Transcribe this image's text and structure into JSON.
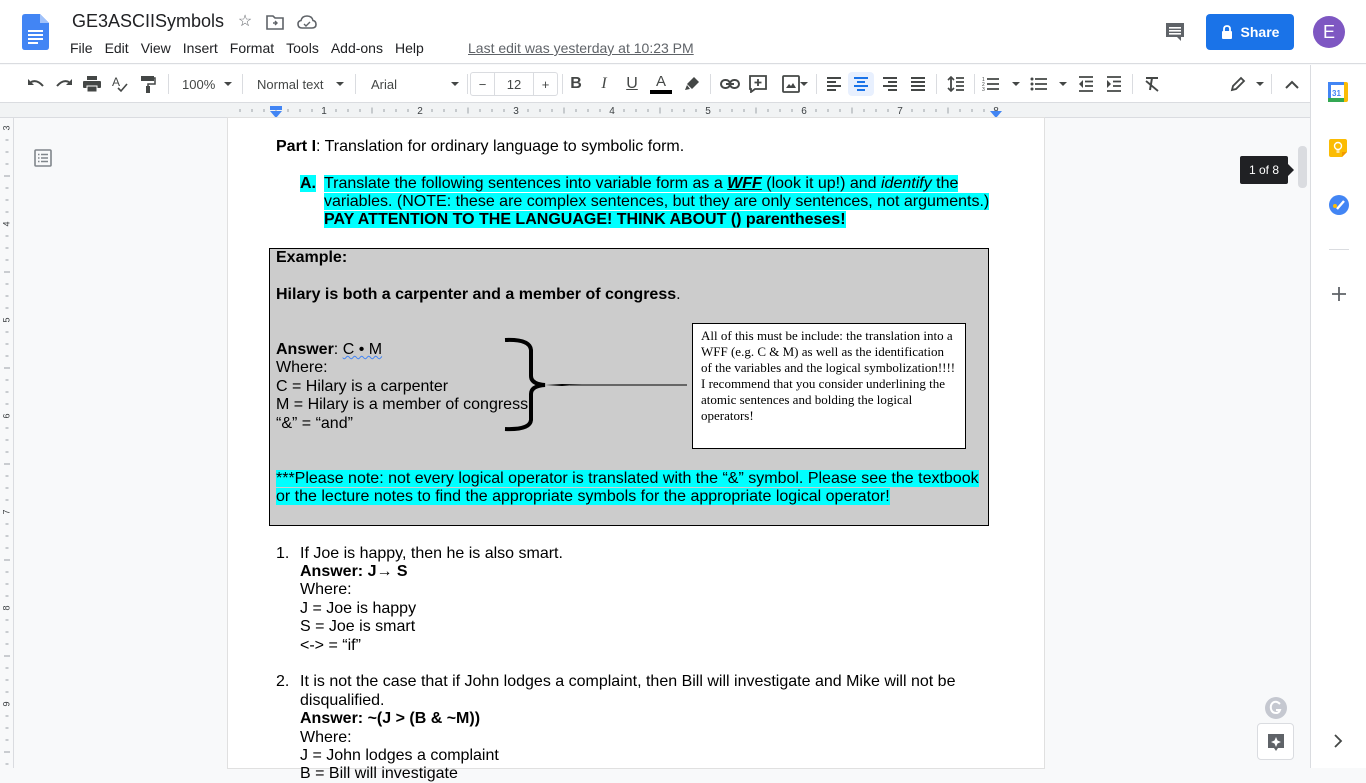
{
  "app": {
    "doc_title": "GE3ASCIISymbols",
    "last_edit": "Last edit was yesterday at 10:23 PM",
    "share_label": "Share",
    "avatar_initial": "E",
    "menu": [
      "File",
      "Edit",
      "View",
      "Insert",
      "Format",
      "Tools",
      "Add-ons",
      "Help"
    ]
  },
  "toolbar": {
    "zoom": "100%",
    "style": "Normal text",
    "font": "Arial",
    "font_size": "12",
    "minus": "−",
    "plus": "+",
    "active_align": "center",
    "text_color": "#000000"
  },
  "ruler": {
    "h_labels": [
      "1",
      "2",
      "3",
      "4",
      "5",
      "6",
      "7",
      "8"
    ],
    "v_labels": [
      "3",
      "4",
      "5",
      "6",
      "7",
      "8",
      "9"
    ]
  },
  "page_indicator": "1 of 8",
  "document": {
    "part_heading_bold": "Part I",
    "part_heading_rest": ": Translation for ordinary language to symbolic form.",
    "section_a": {
      "marker": "A.",
      "line1_a": "Translate the following sentences into variable form as a ",
      "line1_wff": "WFF",
      "line1_b": " (look it up!) and ",
      "line1_identify": "identify",
      "line1_c": " the",
      "line2": "variables. (NOTE: these are complex sentences, but they are only sentences, not arguments.)",
      "line3": "PAY ATTENTION TO THE LANGUAGE! THINK ABOUT () parentheses!"
    },
    "example": {
      "label": "Example:",
      "sentence": "Hilary is both a carpenter and a member of congress",
      "sentence_end": ".",
      "answer_label": "Answer",
      "answer_colon": ": ",
      "answer_value": "C • M",
      "where": "Where:",
      "vars": [
        "C = Hilary is a carpenter",
        "M = Hilary is a member of congress",
        "“&” = “and”"
      ],
      "note_box": "All of this must be include: the translation into a WFF (e.g. C & M) as well as the identification of the variables and the logical symbolization!!!! I recommend that you consider underlining the atomic sentences and bolding the logical operators!",
      "footnote_line1": "***Please note: not every logical operator is translated with the “&” symbol. Please see the textbook",
      "footnote_line2": "or the lecture notes to find the appropriate symbols for the appropriate logical operator!"
    },
    "items": [
      {
        "number": "1.",
        "question": "If Joe is happy, then he is also smart.",
        "answer": "Answer: J→ S",
        "where": "Where:",
        "vars": [
          "J = Joe is happy",
          "S = Joe is smart",
          "<-> = “if”"
        ]
      },
      {
        "number": "2.",
        "question_line1": "It is not the case that if John lodges a complaint, then Bill will investigate and Mike will not be",
        "question_line2": "disqualified.",
        "answer": "Answer: ~(J > (B & ~M))",
        "where": "Where:",
        "vars": [
          "J = John lodges a complaint",
          "B = Bill will investigate"
        ]
      }
    ]
  },
  "colors": {
    "share_blue": "#1a73e8",
    "highlight_cyan": "#00ffff",
    "example_gray": "#cccccc",
    "avatar_purple": "#7e57c2"
  }
}
